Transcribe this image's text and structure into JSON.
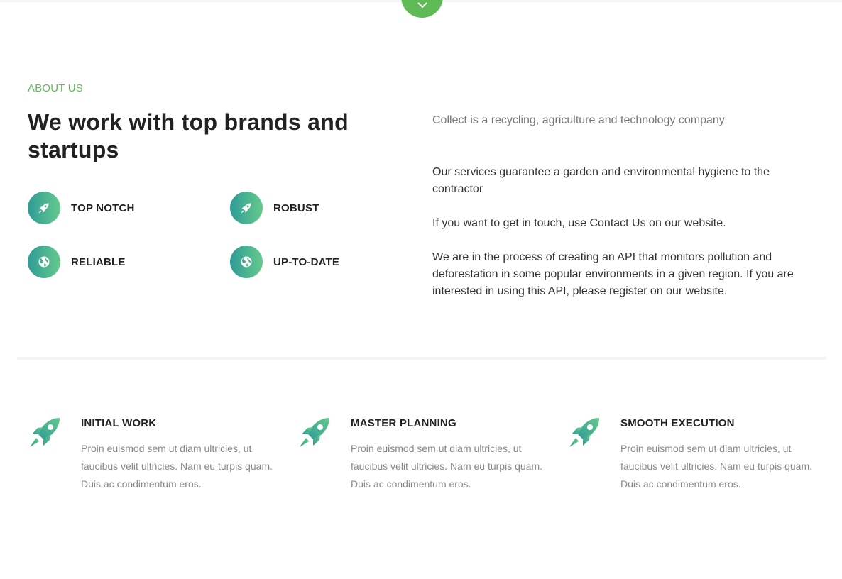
{
  "about": {
    "eyebrow": "ABOUT US",
    "headline": "We work with top brands and startups",
    "features": [
      {
        "label": "TOP NOTCH",
        "icon": "rocket-icon"
      },
      {
        "label": "ROBUST",
        "icon": "rocket-icon"
      },
      {
        "label": "RELIABLE",
        "icon": "globe-icon"
      },
      {
        "label": "UP-TO-DATE",
        "icon": "globe-icon"
      }
    ],
    "lead": "Collect is a recycling, agriculture and technology company",
    "paragraphs": [
      "Our services guarantee a garden and environmental hygiene to the contractor",
      "If you want to get in touch, use Contact Us on our website.",
      "We are in the process of creating an API that monitors pollution and deforestation in some popular environments in a given region. If you are interested in using this API, please register on our website."
    ]
  },
  "services": [
    {
      "title": "INITIAL WORK",
      "text": "Proin euismod sem ut diam ultricies, ut faucibus velit ultricies. Nam eu turpis quam. Duis ac condimentum eros.",
      "icon": "rocket-icon"
    },
    {
      "title": "MASTER PLANNING",
      "text": "Proin euismod sem ut diam ultricies, ut faucibus velit ultricies. Nam eu turpis quam. Duis ac condimentum eros.",
      "icon": "rocket-icon"
    },
    {
      "title": "SMOOTH EXECUTION",
      "text": "Proin euismod sem ut diam ultricies, ut faucibus velit ultricies. Nam eu turpis quam. Duis ac condimentum eros.",
      "icon": "rocket-icon"
    }
  ],
  "colors": {
    "accent": "#5dba55",
    "gradient_start": "#2f9c97",
    "gradient_end": "#65c98c",
    "heading": "#222222",
    "muted_text": "#888888"
  }
}
